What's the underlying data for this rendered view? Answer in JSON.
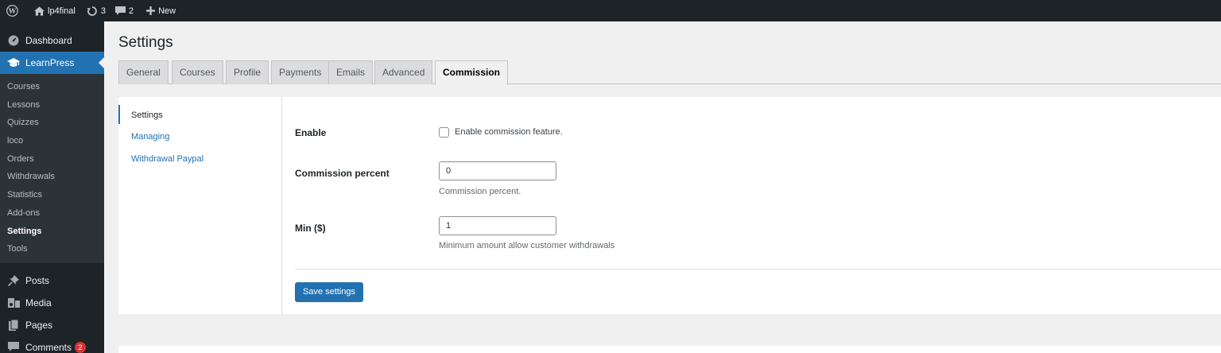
{
  "adminbar": {
    "site_name": "lp4final",
    "updates_count": "3",
    "comments_count": "2",
    "new_label": "New"
  },
  "sidebar": {
    "dashboard": "Dashboard",
    "learnpress": "LearnPress",
    "submenu": [
      "Courses",
      "Lessons",
      "Quizzes",
      "loco",
      "Orders",
      "Withdrawals",
      "Statistics",
      "Add-ons",
      "Settings",
      "Tools"
    ],
    "posts": "Posts",
    "media": "Media",
    "pages": "Pages",
    "comments": "Comments",
    "comments_badge": "2"
  },
  "page": {
    "title": "Settings",
    "tabs": [
      "General",
      "Courses",
      "Profile",
      "Payments",
      "Emails",
      "Advanced",
      "Commission"
    ],
    "active_tab": "Commission"
  },
  "subnav": {
    "items": [
      "Settings",
      "Managing",
      "Withdrawal Paypal"
    ]
  },
  "form": {
    "enable_label": "Enable",
    "enable_checkbox_text": "Enable commission feature.",
    "enable_checked": false,
    "commission_percent_label": "Commission percent",
    "commission_percent_value": "0",
    "commission_percent_desc": "Commission percent.",
    "min_label": "Min ($)",
    "min_value": "1",
    "min_desc": "Minimum amount allow customer withdrawals",
    "save_label": "Save settings"
  },
  "colors": {
    "accent": "#2271b1",
    "adminbar_bg": "#1d2327",
    "badge": "#d63638"
  }
}
